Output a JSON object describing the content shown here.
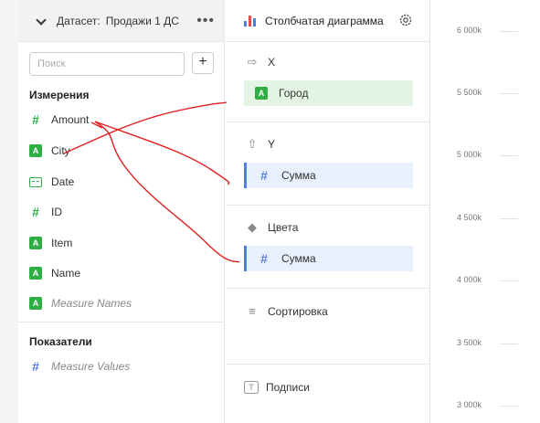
{
  "dataset": {
    "label": "Датасет:",
    "name": "Продажи 1 ДС",
    "menu": "•••"
  },
  "search": {
    "placeholder": "Поиск",
    "add_label": "+"
  },
  "dimensions": {
    "title": "Измерения",
    "items": [
      {
        "label": "Amount",
        "icon": "hash-icon"
      },
      {
        "label": "City",
        "icon": "text-type-icon"
      },
      {
        "label": "Date",
        "icon": "date-type-icon"
      },
      {
        "label": "ID",
        "icon": "hash-icon"
      },
      {
        "label": "Item",
        "icon": "text-type-icon"
      },
      {
        "label": "Name",
        "icon": "text-type-icon"
      },
      {
        "label": "Measure Names",
        "icon": "text-type-icon"
      }
    ]
  },
  "measures": {
    "title": "Показатели",
    "items": [
      {
        "label": "Measure Values",
        "icon": "hash-icon"
      }
    ]
  },
  "visualization": {
    "title": "Столбчатая диаграмма",
    "bar_colors": [
      "#4f7ae8",
      "#e84d4d",
      "#4f7ae8"
    ],
    "sections": {
      "x": {
        "label": "X",
        "field": "Город",
        "field_icon": "text-type-icon"
      },
      "y": {
        "label": "Y",
        "field": "Сумма",
        "field_icon": "hash-icon"
      },
      "colors": {
        "label": "Цвета",
        "field": "Сумма",
        "field_icon": "hash-icon"
      },
      "sort": {
        "label": "Сортировка"
      },
      "labels": {
        "label": "Подписи"
      }
    }
  },
  "axis_ticks": [
    "6 000k",
    "5 500k",
    "5 000k",
    "4 500k",
    "4 000k",
    "3 500k",
    "3 000k"
  ],
  "colors": {
    "dimension_green": "#2fae44",
    "measure_blue": "#4f7ae8",
    "annotation_red": "#e02020"
  }
}
